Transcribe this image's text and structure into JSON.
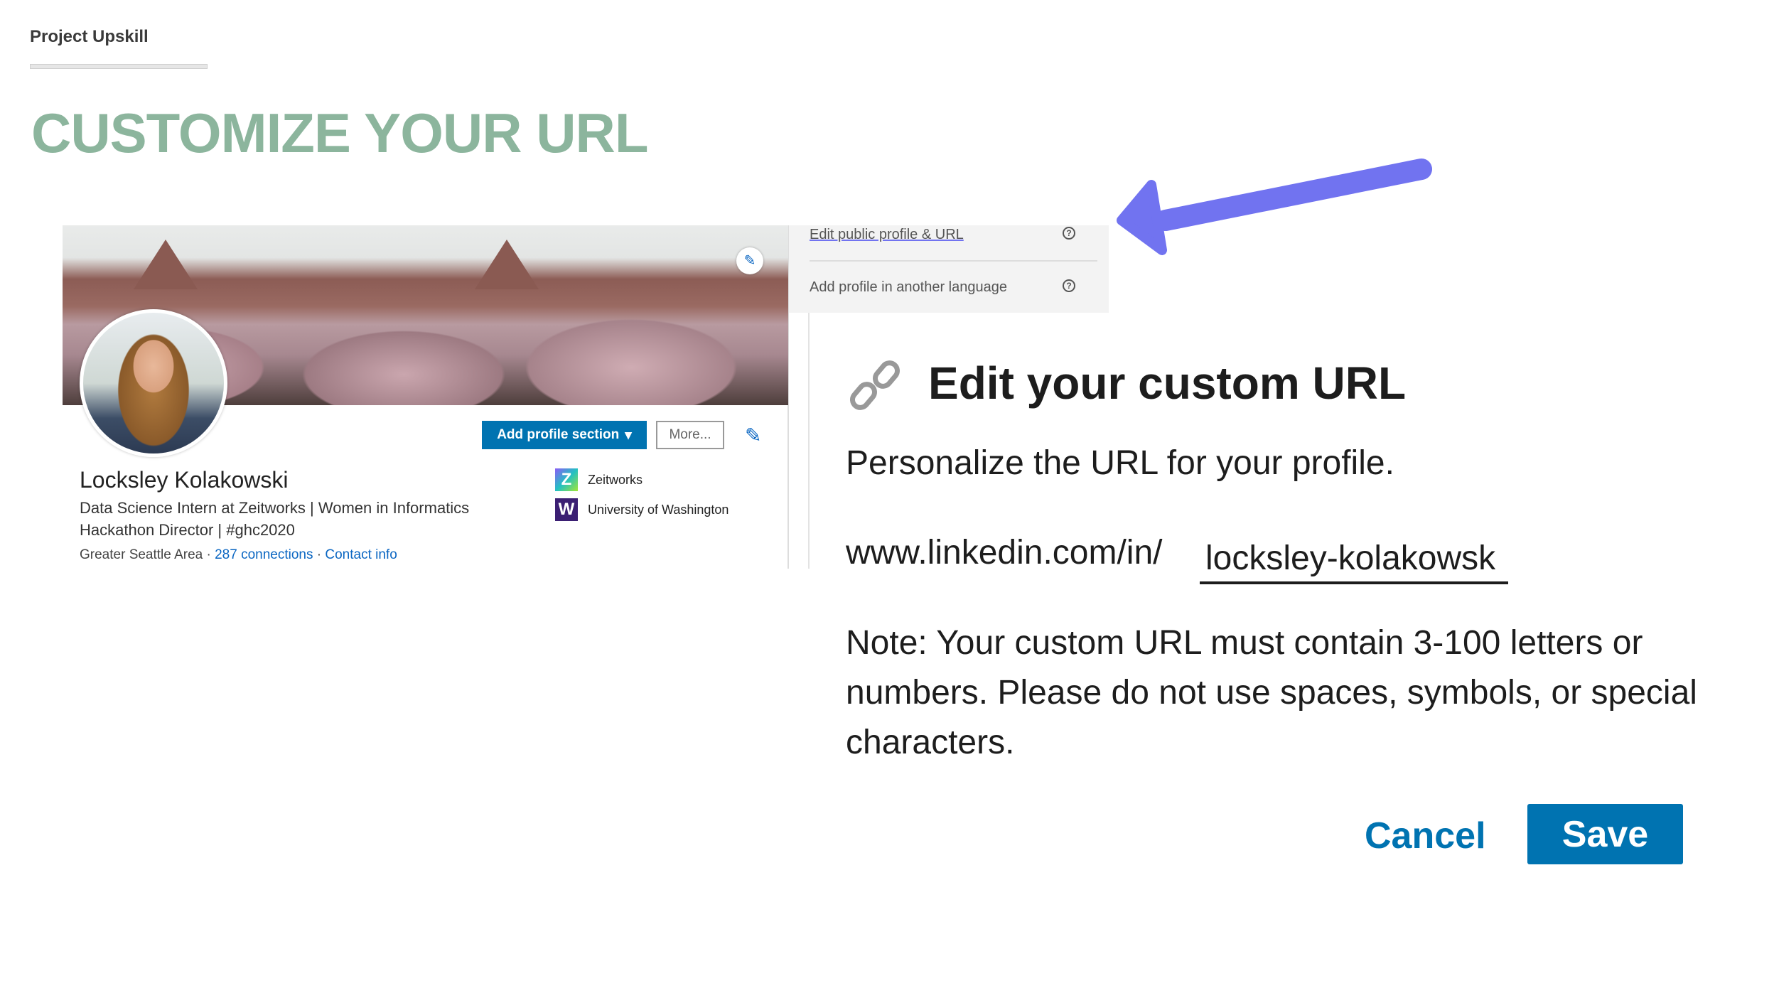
{
  "brand": "Project Upskill",
  "slide_title": "CUSTOMIZE YOUR URL",
  "profile": {
    "add_section_label": "Add profile section",
    "more_label": "More...",
    "name": "Locksley Kolakowski",
    "headline_line1": "Data Science Intern at Zeitworks | Women in Informatics",
    "headline_line2": "Hackathon Director | #ghc2020",
    "location": "Greater Seattle Area",
    "separator": "·",
    "connections": "287 connections",
    "contact": "Contact info",
    "orgs": [
      {
        "name": "Zeitworks",
        "logo": "Z"
      },
      {
        "name": "University of Washington",
        "logo": "W"
      }
    ]
  },
  "menu": {
    "items": [
      "Edit public profile & URL",
      "Add profile in another language"
    ],
    "help_glyph": "?"
  },
  "dialog": {
    "title": "Edit your custom URL",
    "subtitle": "Personalize the URL for your profile.",
    "url_prefix": "www.linkedin.com/in/",
    "url_value": "locksley-kolakowsk",
    "note": "Note: Your custom URL must contain 3-100 letters or numbers. Please do not use spaces, symbols, or special characters.",
    "cancel_label": "Cancel",
    "save_label": "Save"
  },
  "colors": {
    "title": "#8cb59d",
    "linkedin_blue": "#0073b1",
    "arrow": "#7173f0"
  }
}
